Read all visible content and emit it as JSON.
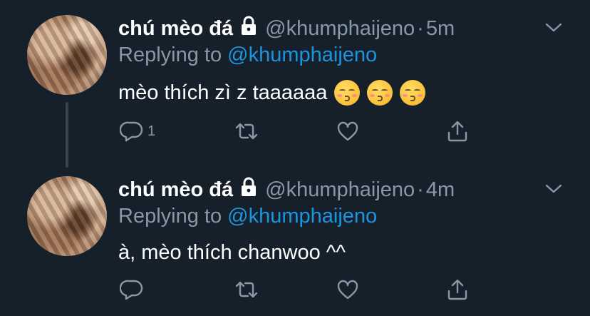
{
  "tweets": [
    {
      "display_name": "chú mèo đá",
      "handle": "@khumphaijeno",
      "dot": "·",
      "time": "5m",
      "replying_prefix": "Replying to ",
      "replying_handle": "@khumphaijeno",
      "text": "mèo thích zì z taaaaaa",
      "emojis": [
        "kissing-face-with-smiling-eyes",
        "kissing-face-with-smiling-eyes",
        "kissing-face-with-smiling-eyes"
      ],
      "reply_count": "1"
    },
    {
      "display_name": "chú mèo đá",
      "handle": "@khumphaijeno",
      "dot": "·",
      "time": "4m",
      "replying_prefix": "Replying to ",
      "replying_handle": "@khumphaijeno",
      "text": "à, mèo thích chanwoo ^^",
      "emojis": [],
      "reply_count": ""
    }
  ],
  "icons": [
    "lock-icon",
    "chevron-down-icon",
    "reply-icon",
    "retweet-icon",
    "like-icon",
    "share-icon"
  ],
  "colors": {
    "background": "#15202b",
    "secondary_text": "#8899a6",
    "link": "#1b95e0",
    "thread_line": "#38444d"
  }
}
